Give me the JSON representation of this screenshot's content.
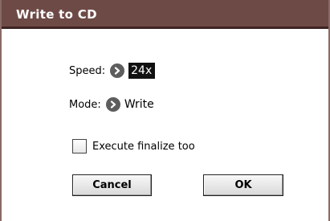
{
  "dialog": {
    "title": "Write to CD",
    "speed": {
      "label": "Speed:",
      "value": "24x",
      "button_icon": "chevron-right-icon"
    },
    "mode": {
      "label": "Mode:",
      "value": "Write",
      "button_icon": "chevron-right-icon"
    },
    "finalize": {
      "label": "Execute finalize too",
      "checked": false
    },
    "buttons": {
      "cancel_label": "Cancel",
      "ok_label": "OK"
    }
  },
  "colors": {
    "titlebar": "#6e4a46",
    "titlebar_text": "#ffffff",
    "selected_value_bg": "#111111"
  }
}
